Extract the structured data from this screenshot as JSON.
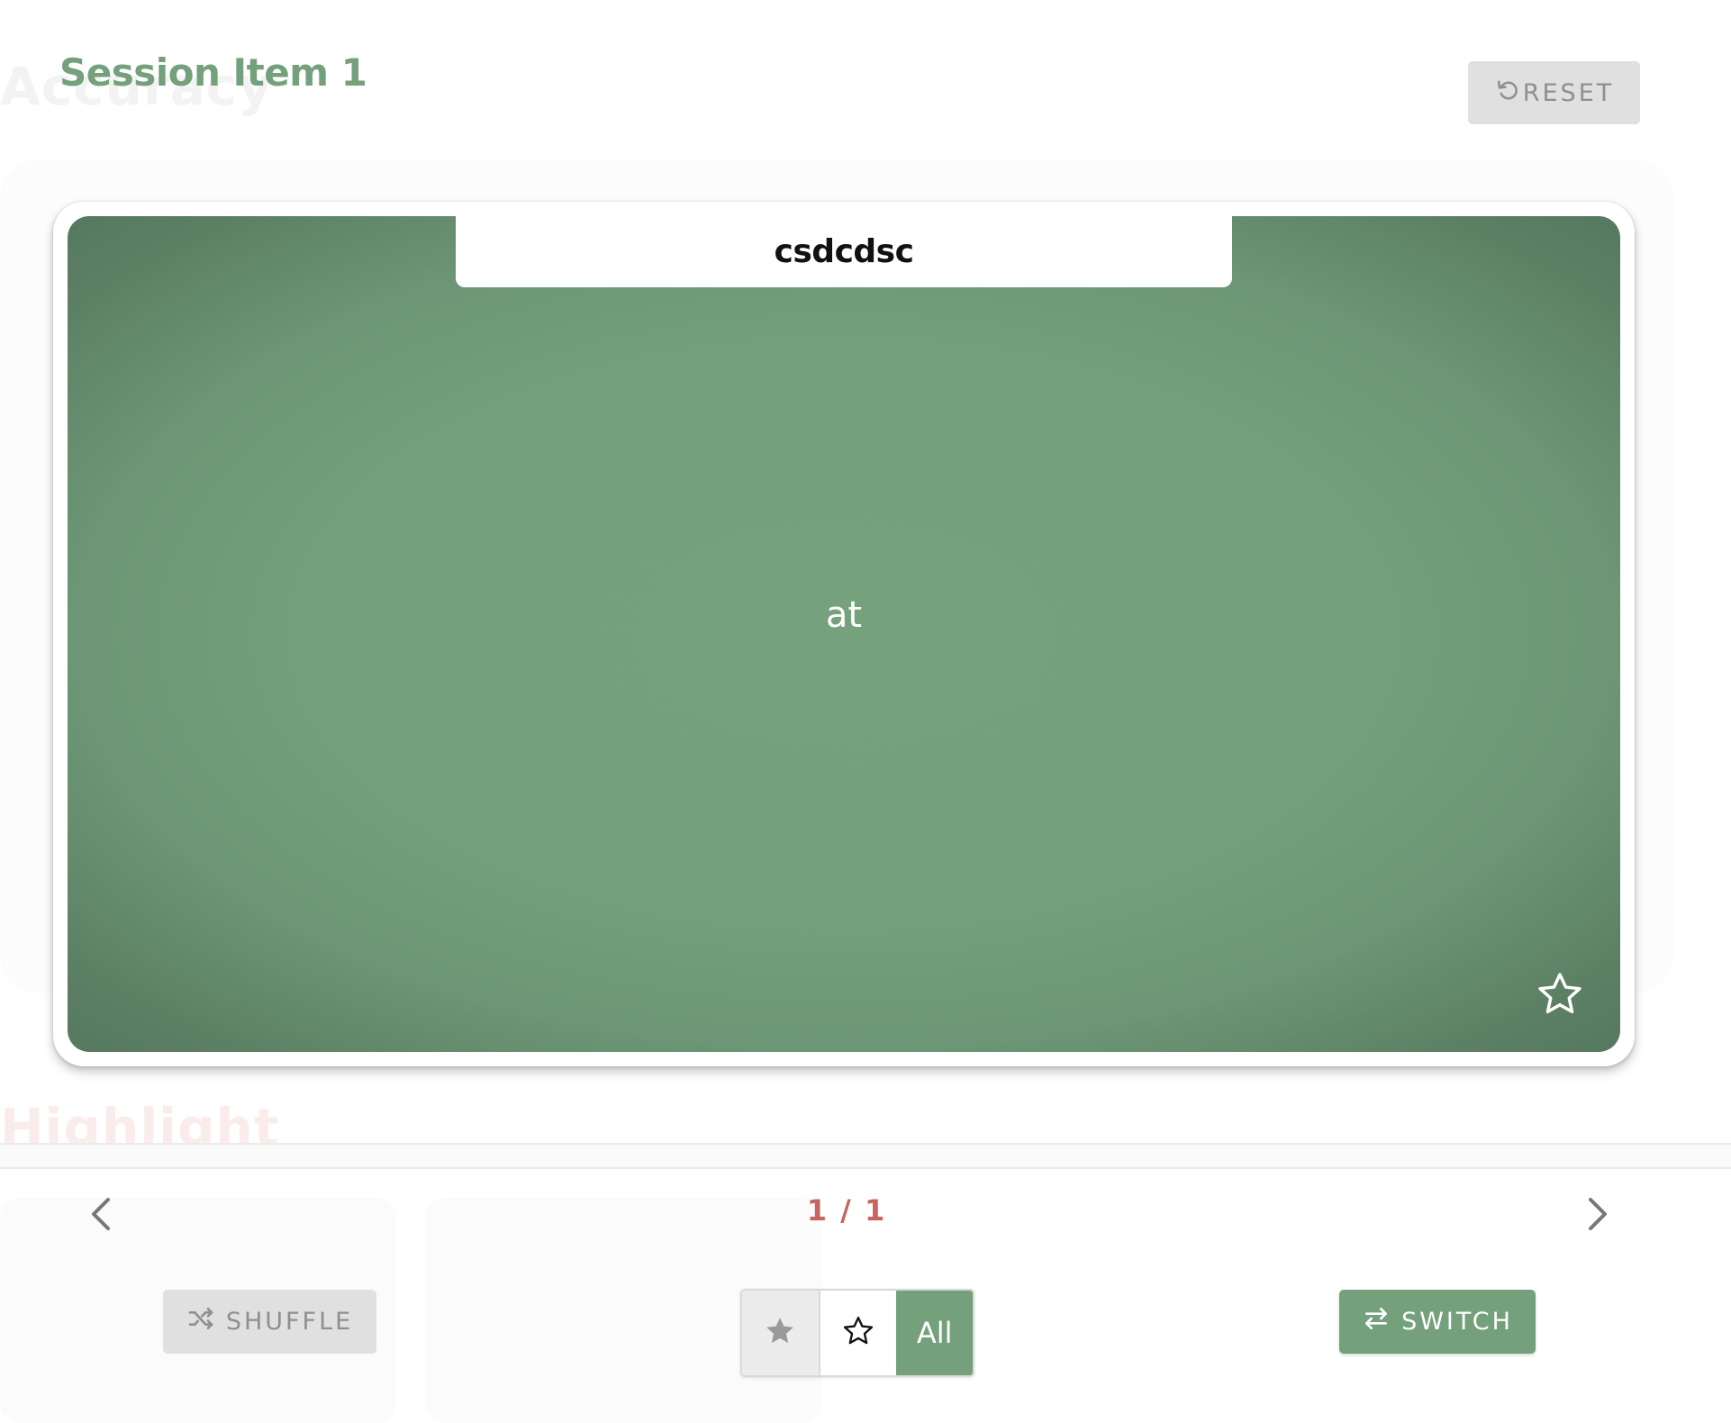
{
  "header": {
    "title": "Session Item 1",
    "reset_label": "RESET",
    "background_heading": "Accuracy"
  },
  "card": {
    "tab_label": "csdcdsc",
    "content": "at",
    "starred": false
  },
  "section": {
    "background_heading": "Highlight"
  },
  "navigation": {
    "counter": "1 / 1"
  },
  "controls": {
    "shuffle_label": "SHUFFLE",
    "switch_label": "SWITCH",
    "filter": {
      "all_label": "All",
      "selected": "All"
    }
  },
  "icons": {
    "reset": "reset-icon",
    "star": "star-outline-icon",
    "prev": "chevron-left-icon",
    "next": "chevron-right-icon",
    "shuffle": "shuffle-icon",
    "switch": "swap-arrows-icon",
    "filter_starred": "star-filled-icon",
    "filter_unstarred": "star-outline-icon"
  },
  "colors": {
    "accent": "#74a07c",
    "counter": "#c8645f",
    "button_gray": "#e0e0e0",
    "button_text_gray": "#8f8f8f"
  }
}
